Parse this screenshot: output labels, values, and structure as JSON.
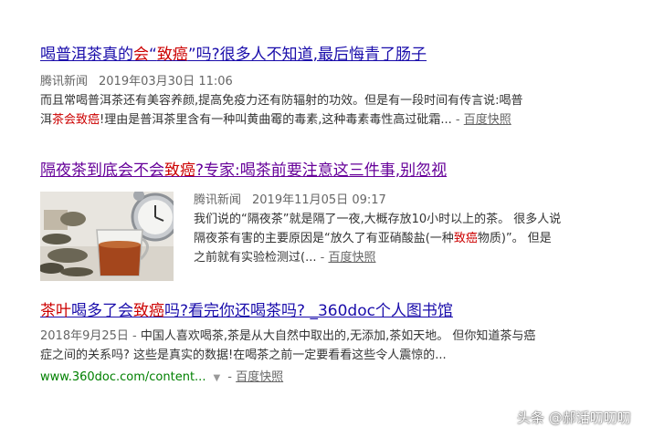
{
  "results": [
    {
      "title_parts": [
        "喝普洱茶真的",
        "会",
        "“",
        "致癌",
        "”吗?很多人不知道,最后悔青了肠子"
      ],
      "source": "腾讯新闻",
      "date": "2019年03月30日 11:06",
      "snippet_line1": "而且常喝普洱茶还有美容养颜,提高免疫力还有防辐射的功效。但是有一段时间有传言说:喝普",
      "snippet_line2_pre": "洱",
      "snippet_line2_hl": "茶会致癌",
      "snippet_line2_post": "!理由是普洱茶里含有一种叫黄曲霉的毒素,这种毒素毒性高过砒霜...",
      "snapshot": "百度快照"
    },
    {
      "title_parts": [
        "隔夜茶到底会不会",
        "致癌",
        "?专家:喝茶前要注意这三件事,别忽视"
      ],
      "source": "腾讯新闻",
      "date": "2019年11月05日 09:17",
      "snippet_line1": "我们说的“隔夜茶”就是隔了一夜,大概存放10小时以上的茶。 很多人说",
      "snippet_line2_pre": "隔夜茶有害的主要原因是“放久了有亚硝酸盐(一种",
      "snippet_line2_hl": "致癌",
      "snippet_line2_post": "物质)”。 但是",
      "snippet_line3": "之前就有实验检测过(...",
      "snapshot": "百度快照",
      "thumbnail": "teacup-with-alarm-clock-image"
    },
    {
      "title_parts": [
        "茶叶",
        "喝多了会",
        "致癌",
        "吗?看完你还喝茶吗? _360doc个人图书馆"
      ],
      "date": "2018年9月25日",
      "snippet_line1": "中国人喜欢喝茶,茶是从大自然中取出的,无添加,茶如天地。 但你知道茶与癌",
      "snippet_line2": "症之间的关系吗? 这些是真实的数据!在喝茶之前一定要看看这些令人震惊的...",
      "url": "www.360doc.com/content...",
      "snapshot": "百度快照"
    }
  ],
  "watermark": "头条 @郝话叨叨叨",
  "separator": " - ",
  "colors": {
    "link": "#1a0dab",
    "visited": "#660099",
    "highlight": "#cc0000",
    "url": "#008000"
  }
}
